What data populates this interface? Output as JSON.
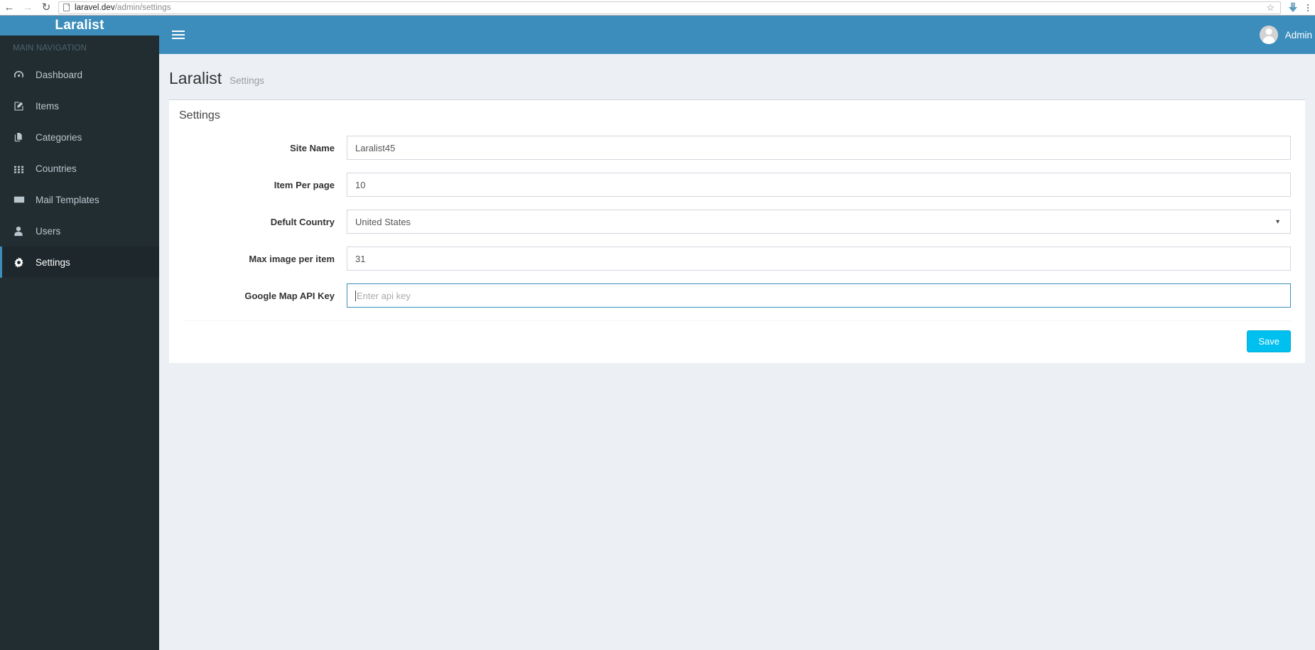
{
  "browser": {
    "back_icon": "back-arrow-icon",
    "forward_icon": "forward-arrow-icon",
    "reload_icon": "reload-icon",
    "url_host": "laravel.dev",
    "url_path": "/admin/settings",
    "bookmark_icon": "star-icon",
    "download_icon": "download-icon",
    "menu_icon": "three-dot-menu-icon"
  },
  "sidebar": {
    "logo": "Laralist",
    "section_header": "MAIN NAVIGATION",
    "items": [
      {
        "label": "Dashboard",
        "icon": "dashboard-icon",
        "active": false
      },
      {
        "label": "Items",
        "icon": "edit-icon",
        "active": false
      },
      {
        "label": "Categories",
        "icon": "copy-icon",
        "active": false
      },
      {
        "label": "Countries",
        "icon": "grid-icon",
        "active": false
      },
      {
        "label": "Mail Templates",
        "icon": "envelope-icon",
        "active": false
      },
      {
        "label": "Users",
        "icon": "user-icon",
        "active": false
      },
      {
        "label": "Settings",
        "icon": "gear-icon",
        "active": true
      }
    ]
  },
  "topbar": {
    "toggle_icon": "hamburger-icon",
    "user_name": "Admin",
    "avatar_icon": "avatar-icon"
  },
  "content": {
    "page_title": "Laralist",
    "page_subtitle": "Settings",
    "box_title": "Settings",
    "save_label": "Save",
    "fields": [
      {
        "label": "Site Name",
        "value": "Laralist45",
        "placeholder": "",
        "type": "text",
        "focused": false
      },
      {
        "label": "Item Per page",
        "value": "10",
        "placeholder": "",
        "type": "text",
        "focused": false
      },
      {
        "label": "Defult Country",
        "value": "United States",
        "placeholder": "",
        "type": "select",
        "focused": false
      },
      {
        "label": "Max image per item",
        "value": "31",
        "placeholder": "",
        "type": "text",
        "focused": false
      },
      {
        "label": "Google Map API Key",
        "value": "",
        "placeholder": "Enter api key",
        "type": "text",
        "focused": true
      }
    ]
  },
  "colors": {
    "brand_blue": "#3c8dbc",
    "sidebar_dark": "#222d32",
    "sidebar_active": "#1e282c",
    "content_bg": "#ecf0f5",
    "save_button": "#00c0ef"
  }
}
